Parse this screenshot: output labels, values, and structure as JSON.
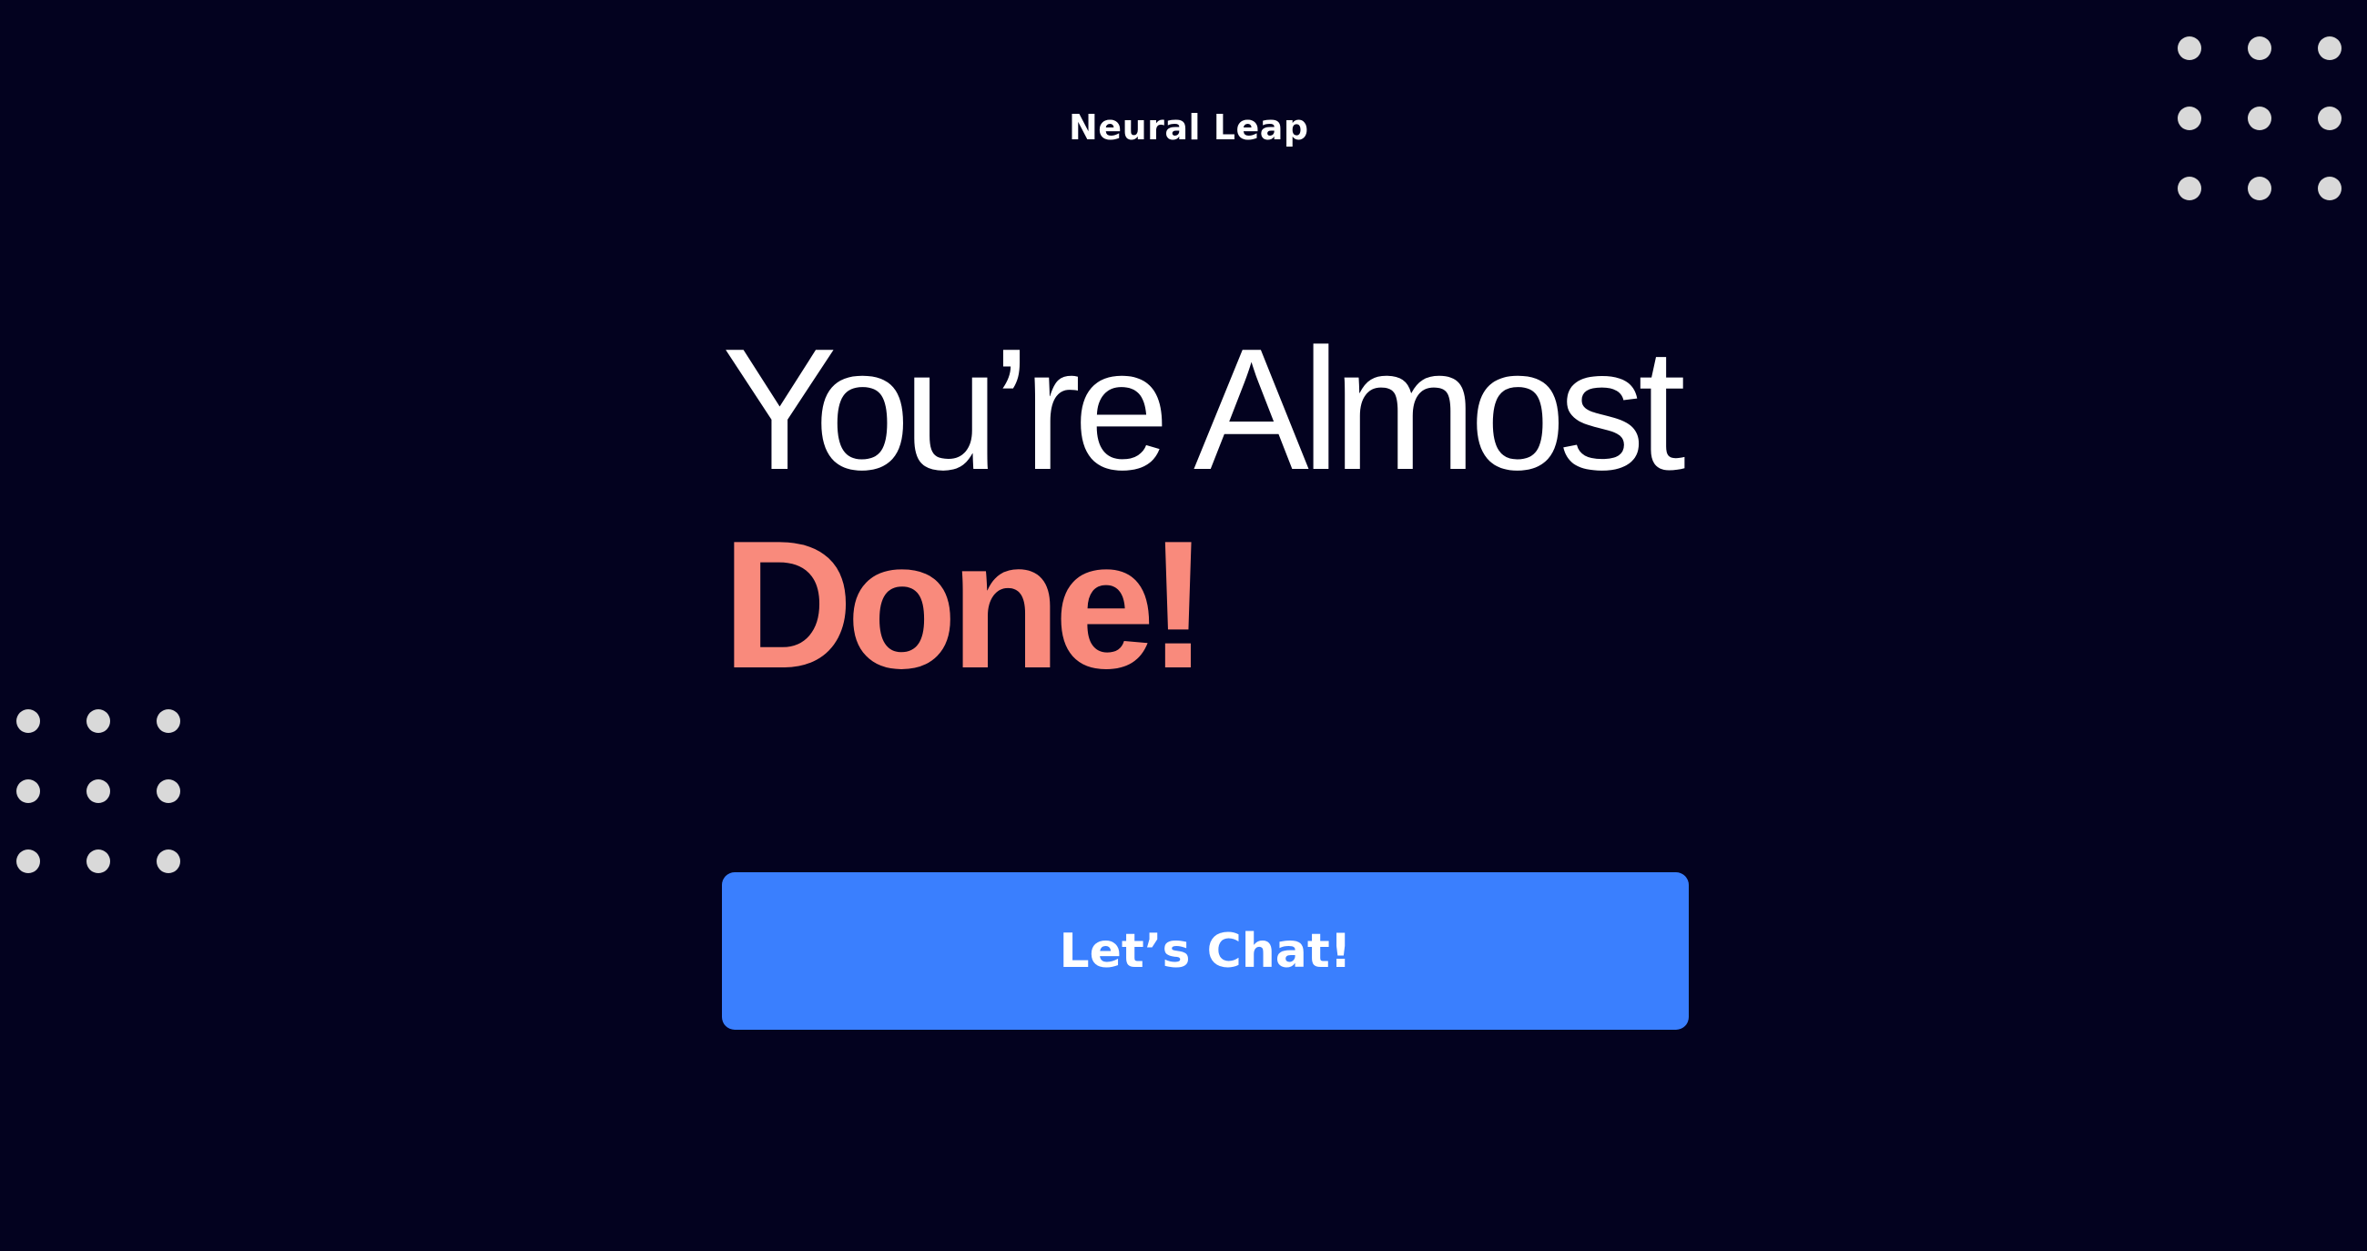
{
  "brand": {
    "name": "Neural Leap"
  },
  "hero": {
    "headline_line1": "You’re Almost",
    "headline_line2": "Done!"
  },
  "cta": {
    "label": "Let’s Chat!"
  },
  "colors": {
    "background": "#03021f",
    "accent": "#f98a7c",
    "button": "#3a7ffe",
    "dots": "#d9d9d9"
  },
  "decorations": {
    "dot_grid_icon": "dot-grid-3x3"
  }
}
